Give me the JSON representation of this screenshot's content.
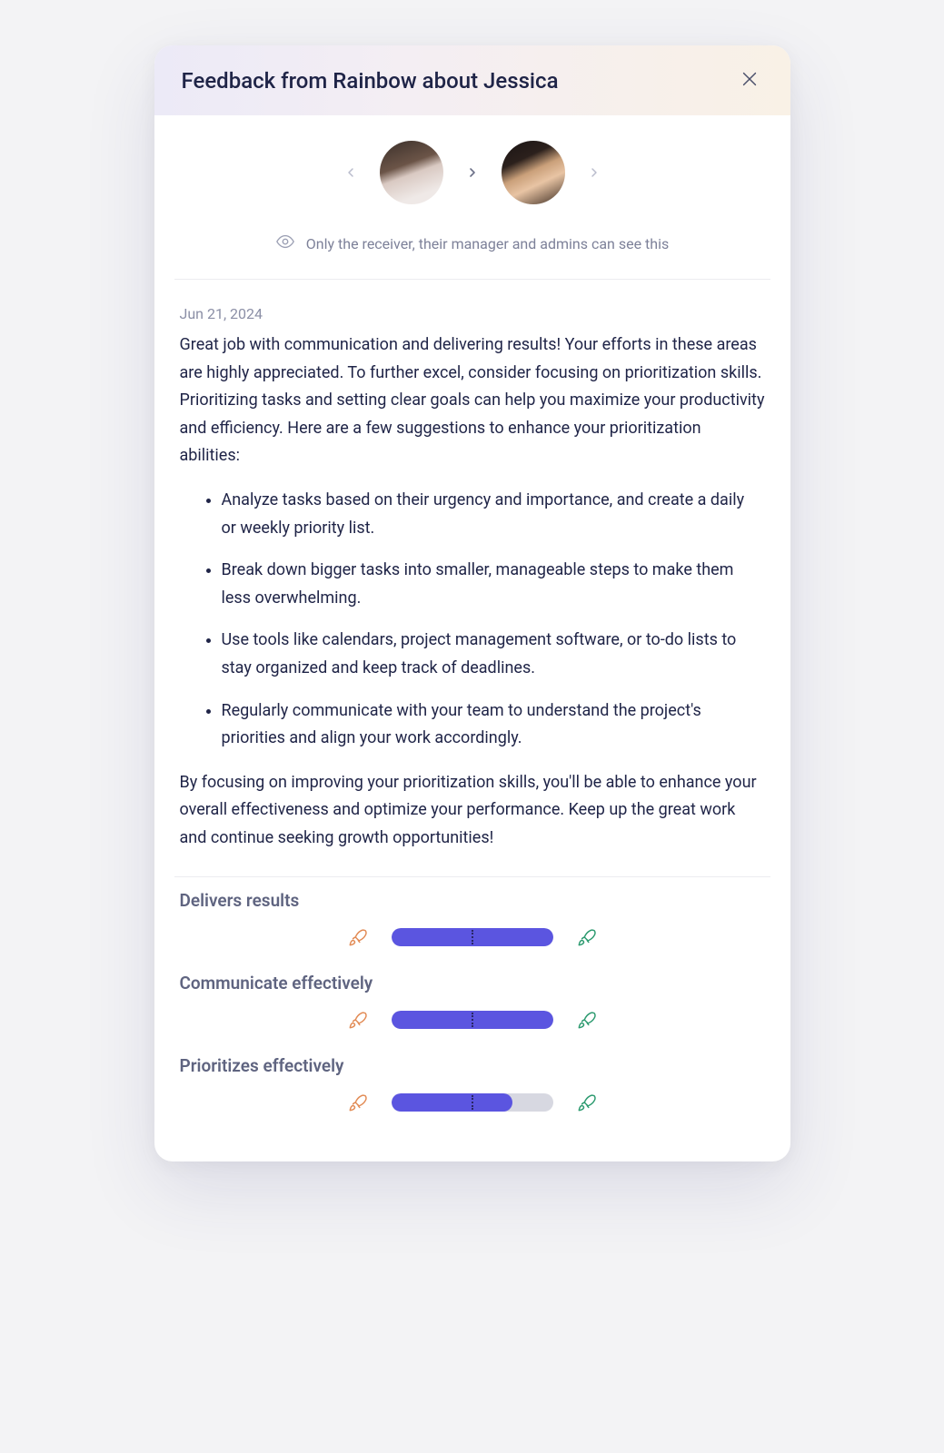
{
  "header": {
    "title": "Feedback from Rainbow about Jessica"
  },
  "visibility": {
    "text": "Only the receiver, their manager and admins can see this"
  },
  "feedback": {
    "date": "Jun 21, 2024",
    "intro": "Great job with communication and delivering results! Your efforts in these areas are highly appreciated. To further excel, consider focusing on prioritization skills. Prioritizing tasks and setting clear goals can help you maximize your productivity and efficiency. Here are a few suggestions to enhance your prioritization abilities:",
    "suggestions": [
      "Analyze tasks based on their urgency and importance, and create a daily or weekly priority list.",
      "Break down bigger tasks into smaller, manageable steps to make them less overwhelming.",
      "Use tools like calendars, project management software, or to-do lists to stay organized and keep track of deadlines.",
      "Regularly communicate with your team to understand the project's priorities and align your work accordingly."
    ],
    "outro": "By focusing on improving your prioritization skills, you'll be able to enhance your overall effectiveness and optimize your performance. Keep up the great work and continue seeking growth opportunities!"
  },
  "skills": [
    {
      "label": "Delivers results",
      "fill_percent": 100
    },
    {
      "label": "Communicate effectively",
      "fill_percent": 100
    },
    {
      "label": "Prioritizes effectively",
      "fill_percent": 75
    }
  ],
  "colors": {
    "accent": "#5b55e0",
    "rocket_low": "#e28b55",
    "rocket_high": "#2c9a6f"
  }
}
